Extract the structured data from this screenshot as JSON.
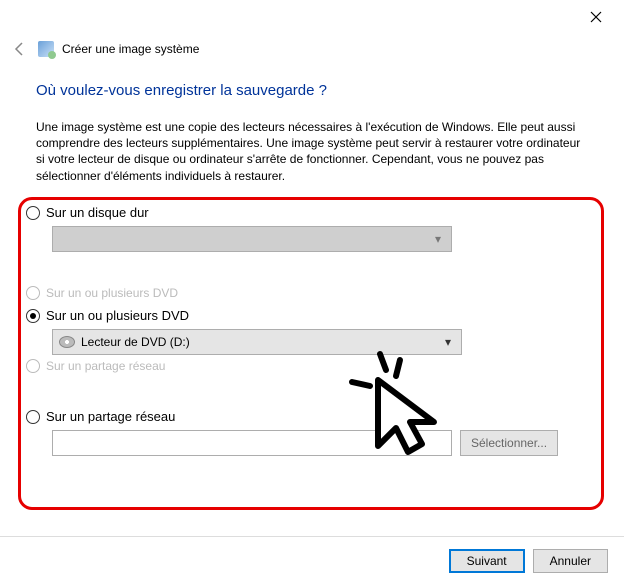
{
  "window": {
    "title": "Créer une image système"
  },
  "main": {
    "question": "Où voulez-vous enregistrer la sauvegarde ?",
    "description": "Une image système est une copie des lecteurs nécessaires à l'exécution de Windows. Elle peut aussi comprendre des lecteurs supplémentaires. Une image système peut servir à restaurer votre ordinateur si votre lecteur de disque ou ordinateur s'arrête de fonctionner. Cependant, vous ne pouvez pas sélectionner d'éléments individuels à restaurer."
  },
  "options": {
    "hdd": {
      "label": "Sur un disque dur",
      "checked": false,
      "select_value": ""
    },
    "dvd_ghost": {
      "label": "Sur un ou plusieurs DVD"
    },
    "dvd": {
      "label": "Sur un ou plusieurs DVD",
      "checked": true,
      "select_value": "Lecteur de DVD (D:)"
    },
    "net_ghost": {
      "label": "Sur un partage réseau"
    },
    "net": {
      "label": "Sur un partage réseau",
      "checked": false,
      "input_value": "",
      "browse": "Sélectionner..."
    }
  },
  "footer": {
    "next": "Suivant",
    "cancel": "Annuler"
  }
}
